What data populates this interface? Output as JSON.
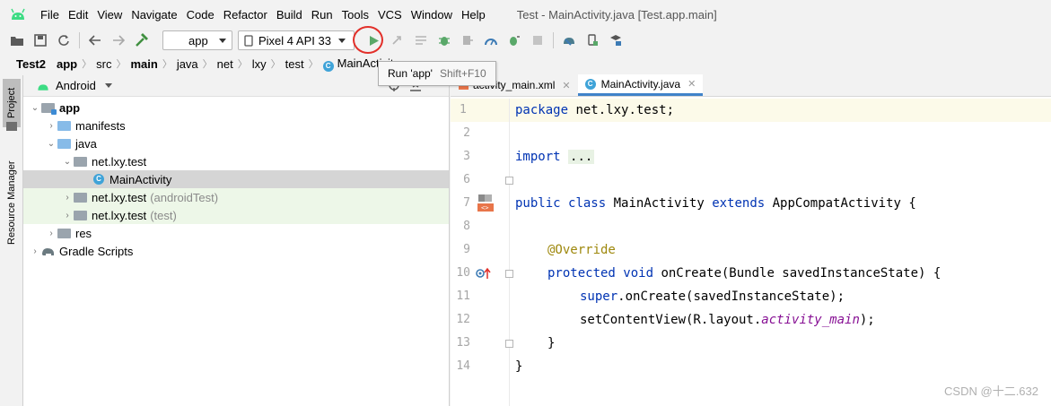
{
  "menubar": {
    "items": [
      "File",
      "Edit",
      "View",
      "Navigate",
      "Code",
      "Refactor",
      "Build",
      "Run",
      "Tools",
      "VCS",
      "Window",
      "Help"
    ],
    "window_title": "Test - MainActivity.java [Test.app.main]"
  },
  "toolbar": {
    "config_combo": "app",
    "device_combo": "Pixel 4 API 33",
    "run_color": "#59a869"
  },
  "breadcrumb": {
    "items": [
      "Test2",
      "app",
      "src",
      "main",
      "java",
      "net",
      "lxy",
      "test"
    ],
    "class_item": "MainActivity"
  },
  "tooltip": {
    "label": "Run 'app'",
    "shortcut": "Shift+F10"
  },
  "toolstrip": {
    "project_tab": "Project",
    "resource_tab": "Resource Manager"
  },
  "project": {
    "view_mode": "Android",
    "tree": [
      {
        "label": "app",
        "muted": ""
      },
      {
        "label": "manifests",
        "muted": ""
      },
      {
        "label": "java",
        "muted": ""
      },
      {
        "label": "net.lxy.test",
        "muted": ""
      },
      {
        "label": "MainActivity",
        "muted": ""
      },
      {
        "label": "net.lxy.test",
        "muted": "(androidTest)"
      },
      {
        "label": "net.lxy.test",
        "muted": "(test)"
      },
      {
        "label": "res",
        "muted": ""
      },
      {
        "label": "Gradle Scripts",
        "muted": ""
      }
    ]
  },
  "editor": {
    "tabs": [
      {
        "label": "activity_main.xml"
      },
      {
        "label": "MainActivity.java"
      }
    ],
    "line_numbers": [
      "1",
      "2",
      "3",
      "6",
      "7",
      "8",
      "9",
      "10",
      "11",
      "12",
      "13",
      "14"
    ],
    "code": {
      "l1_kw": "package",
      "l1_rest": " net.lxy.test;",
      "l3_kw": "import",
      "l3_fold": "...",
      "l7_kw1": "public",
      "l7_kw2": "class",
      "l7_name": " MainActivity ",
      "l7_kw3": "extends",
      "l7_rest": " AppCompatActivity {",
      "l9_ann": "@Override",
      "l10_kw1": "protected",
      "l10_kw2": "void",
      "l10_rest": " onCreate(Bundle savedInstanceState) {",
      "l11_kw": "super",
      "l11_rest": ".onCreate(savedInstanceState);",
      "l12_pre": "setContentView(R.layout.",
      "l12_ital": "activity_main",
      "l12_post": ");",
      "l13": "}",
      "l14": "}"
    }
  },
  "watermark": "CSDN @十二.632"
}
